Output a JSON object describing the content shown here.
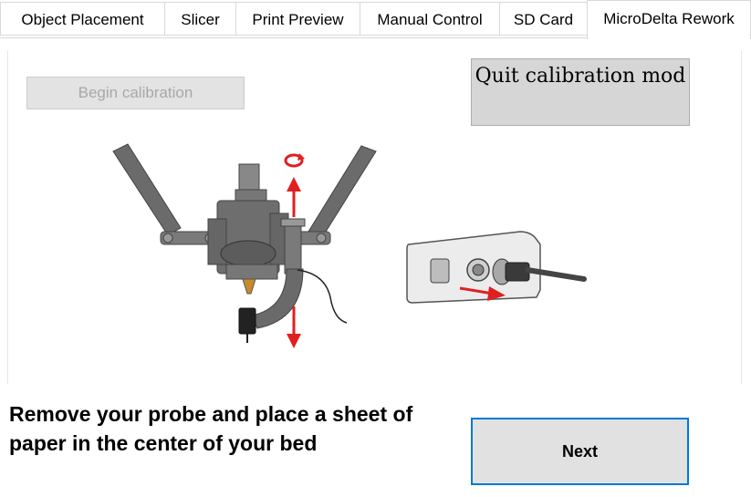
{
  "tabs": [
    {
      "label": "Object Placement"
    },
    {
      "label": "Slicer"
    },
    {
      "label": "Print Preview"
    },
    {
      "label": "Manual Control"
    },
    {
      "label": "SD Card"
    },
    {
      "label": "MicroDelta Rework"
    }
  ],
  "active_tab": "MicroDelta Rework",
  "buttons": {
    "begin_calibration": "Begin calibration",
    "quit_calibration": "Quit calibration mod",
    "next": "Next"
  },
  "instruction": "Remove your probe and place a sheet of paper in the center of your bed",
  "colors": {
    "arrow": "#e02020",
    "focus_border": "#0078d7",
    "disabled_text": "#a8a8a8"
  },
  "icons": {
    "rotate": "rotate-arrow-icon",
    "arrow_up": "arrow-up-icon",
    "arrow_down": "arrow-down-icon",
    "arrow_right": "arrow-right-icon"
  }
}
